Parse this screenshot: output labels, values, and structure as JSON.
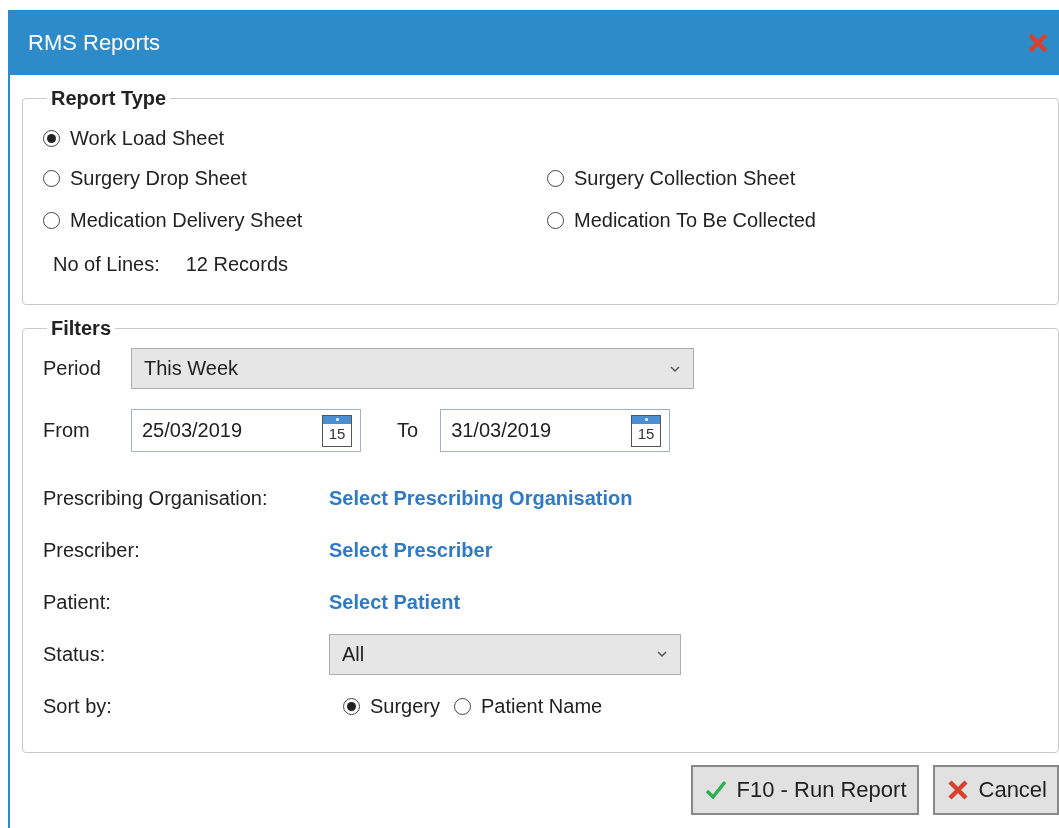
{
  "window": {
    "title": "RMS Reports"
  },
  "report_type": {
    "title": "Report Type",
    "rows": [
      {
        "options": [
          {
            "label": "Work Load Sheet",
            "selected": true
          }
        ]
      },
      {
        "options": [
          {
            "label": "Surgery Drop Sheet",
            "selected": false
          },
          {
            "label": "Surgery Collection Sheet",
            "selected": false
          }
        ]
      },
      {
        "options": [
          {
            "label": "Medication Delivery Sheet",
            "selected": false
          },
          {
            "label": "Medication To Be Collected",
            "selected": false
          }
        ]
      }
    ],
    "lines_label": "No of Lines:",
    "lines_value": "12 Records"
  },
  "filters": {
    "title": "Filters",
    "period": {
      "label": "Period",
      "value": "This Week"
    },
    "from": {
      "label": "From",
      "value": "25/03/2019",
      "calendar_day": "15"
    },
    "to": {
      "label": "To",
      "value": "31/03/2019",
      "calendar_day": "15"
    },
    "links": [
      {
        "label": "Prescribing Organisation:",
        "link": "Select Prescribing Organisation"
      },
      {
        "label": "Prescriber:",
        "link": "Select Prescriber"
      },
      {
        "label": "Patient:",
        "link": "Select Patient"
      }
    ],
    "status": {
      "label": "Status:",
      "value": "All"
    },
    "sort_by": {
      "label": "Sort by:",
      "options": [
        {
          "label": "Surgery",
          "selected": true
        },
        {
          "label": "Patient Name",
          "selected": false
        }
      ]
    }
  },
  "buttons": [
    {
      "kind": "run",
      "label": "F10 - Run Report"
    },
    {
      "kind": "cancel",
      "label": "Cancel"
    }
  ]
}
